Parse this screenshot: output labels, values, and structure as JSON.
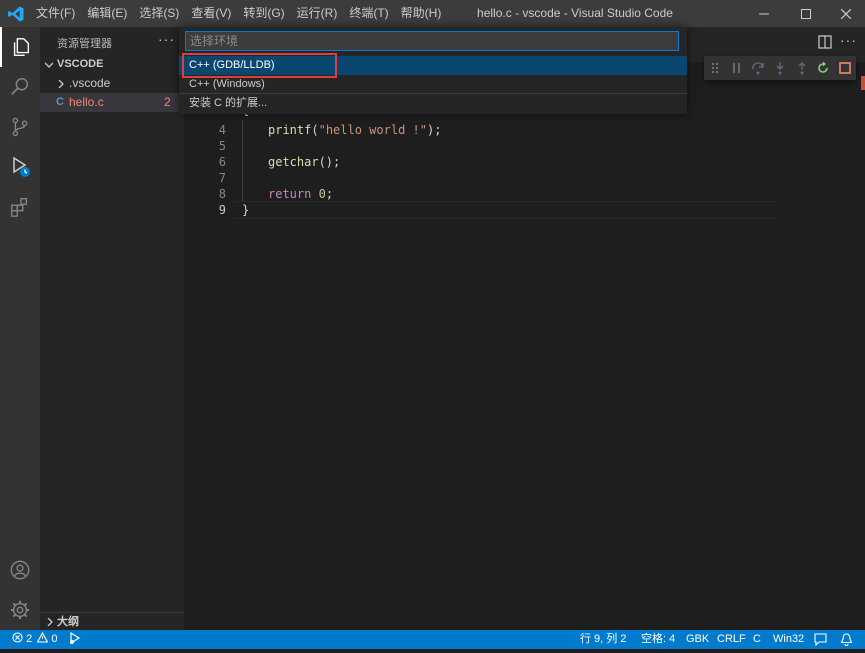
{
  "window": {
    "menu": [
      "文件(F)",
      "编辑(E)",
      "选择(S)",
      "查看(V)",
      "转到(G)",
      "运行(R)",
      "终端(T)",
      "帮助(H)"
    ],
    "title": "hello.c - vscode - Visual Studio Code"
  },
  "sidebar": {
    "title": "资源管理器",
    "more": "···",
    "folder": "VSCODE",
    "items": [
      {
        "name": ".vscode",
        "icon": "chevron-right-icon"
      },
      {
        "name": "hello.c",
        "icon_label": "C",
        "badge": "2"
      }
    ],
    "outline": "大纲"
  },
  "quickpick": {
    "placeholder": "选择环境",
    "items": [
      "C++ (GDB/LLDB)",
      "C++ (Windows)",
      "安装 C 的扩展..."
    ]
  },
  "editor": {
    "line_numbers": [
      "4",
      "5",
      "6",
      "7",
      "8",
      "9"
    ],
    "lines": {
      "l3": "{",
      "l4_fn": "printf",
      "l4_open": "(",
      "l4_str": "\"hello world !\"",
      "l4_close": ");",
      "l6_fn": "getchar",
      "l6_rest": "();",
      "l8_kw": "return",
      "l8_num": "0",
      "l8_end": ";",
      "l9": "}"
    }
  },
  "statusbar": {
    "errors": "2",
    "warnings": "0",
    "position": "行 9, 列 2",
    "spaces": "空格: 4",
    "encoding": "GBK",
    "eol": "CRLF",
    "language": "C",
    "platform": "Win32"
  },
  "colors": {
    "accent": "#007acc",
    "selection": "#094771",
    "highlight_border": "#e03c3c",
    "error_file": "#f48771"
  }
}
